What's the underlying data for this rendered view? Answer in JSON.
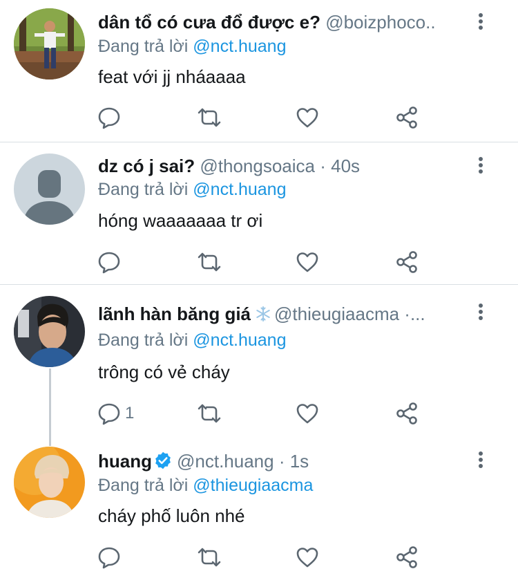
{
  "tweets": [
    {
      "display_name": "dân tổ có cưa đổ được e?",
      "meta": "@boizphoco..",
      "reply_prefix": "Đang trả lời",
      "reply_handle": "@nct.huang",
      "text": "feat với jj nháaaaa",
      "reply_count": "",
      "avatar": "man-standing-in-orchard-photo"
    },
    {
      "display_name": "dz có j sai?",
      "meta": "@thongsoaica · 40s",
      "reply_prefix": "Đang trả lời",
      "reply_handle": "@nct.huang",
      "text": "hóng waaaaaaa tr ơi",
      "reply_count": "",
      "avatar": "default-profile-placeholder"
    },
    {
      "display_name": "lãnh hàn băng giá",
      "meta": "@thieugiaacma ·...",
      "reply_prefix": "Đang trả lời",
      "reply_handle": "@nct.huang",
      "text": "trông có vẻ cháy",
      "reply_count": "1",
      "avatar": "young-man-portrait-photo",
      "name_emoji": "snowflake-icon"
    },
    {
      "display_name": "huang",
      "meta": "@nct.huang · 1s",
      "reply_prefix": "Đang trả lời",
      "reply_handle": "@thieugiaacma",
      "text": "cháy phố luôn nhé",
      "reply_count": "",
      "avatar": "man-orange-background-photo",
      "verified": true
    }
  ],
  "icons": {
    "reply": "reply-icon",
    "retweet": "retweet-icon",
    "like": "heart-icon",
    "share": "share-icon",
    "more": "more-vertical-icon",
    "verified": "verified-badge-icon"
  },
  "colors": {
    "link": "#1b95e0",
    "meta": "#657786",
    "text": "#14171a",
    "divider": "#d9dfe3",
    "verified": "#1da1f2",
    "icon": "#5b6670"
  }
}
